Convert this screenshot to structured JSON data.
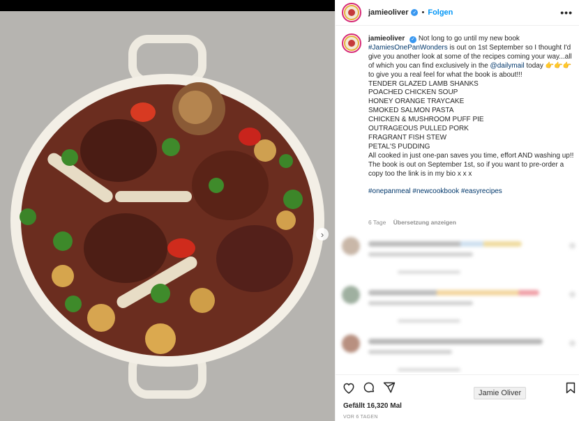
{
  "post": {
    "username": "jamieoliver",
    "follow_label": "Folgen",
    "separator": "•",
    "more_label": "•••",
    "caption": {
      "username": "jamieoliver",
      "line1": "Not long to go until my new book",
      "hashtag_book": "#JamiesOnePanWonders",
      "line2": "is out on 1st September so I thought I'd give you another look at some of the recipes coming your way...all of which you can find exclusively in the",
      "mention": "@dailymail",
      "line3": "today 👉👉👉 to give you a real feel for what the book is about!!!",
      "recipes": [
        "TENDER GLAZED LAMB SHANKS",
        "POACHED CHICKEN SOUP",
        "HONEY ORANGE TRAYCAKE",
        "SMOKED SALMON PASTA",
        "CHICKEN & MUSHROOM PUFF PIE",
        "OUTRAGEOUS PULLED PORK",
        "FRAGRANT FISH STEW",
        "PETAL'S PUDDING"
      ],
      "line4": "All cooked in just one-pan saves you time, effort AND washing up!!",
      "line5": "The book is out on September 1st, so if you want to pre-order a copy too the link is in my bio x x x",
      "hashtags": [
        "#onepanmeal",
        "#newcookbook",
        "#easyrecipes"
      ],
      "age": "6 Tage",
      "translate_label": "Übersetzung anzeigen"
    },
    "likes_text": "Gefällt 16,320 Mal",
    "date_text": "VOR 6 TAGEN",
    "tooltip": "Jamie Oliver",
    "next_arrow": "›"
  },
  "colors": {
    "accent": "#0095f6",
    "link": "#00376b",
    "meta_gray": "#8e8e8e"
  },
  "icons": [
    "verified-badge-icon",
    "more-options-icon",
    "heart-icon",
    "comment-icon",
    "share-icon",
    "bookmark-icon",
    "next-arrow-icon"
  ]
}
